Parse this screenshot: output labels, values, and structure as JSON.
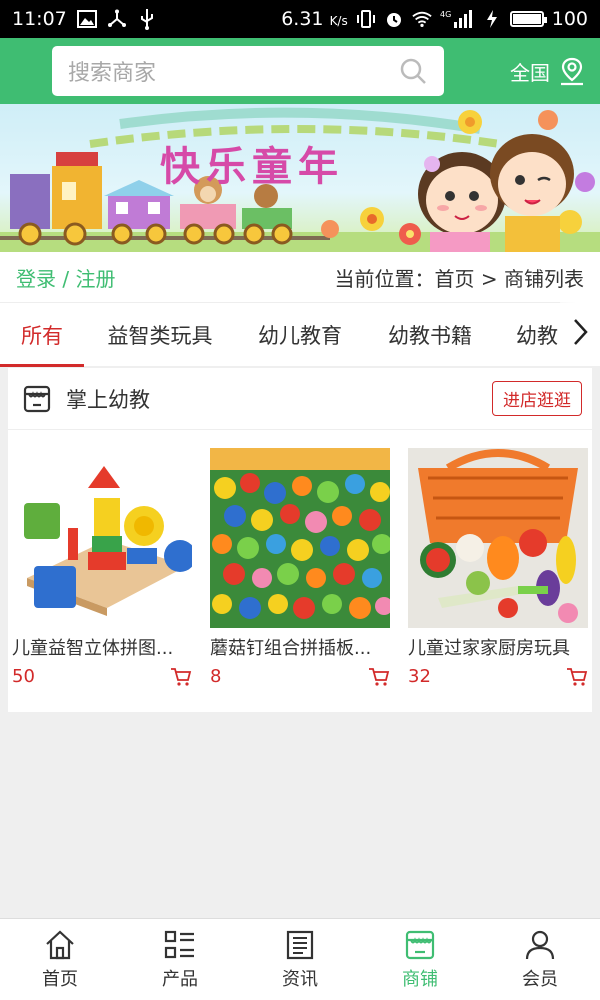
{
  "status_bar": {
    "time": "11:07",
    "speed": "6.31",
    "speed_unit": "K/s",
    "network": "4G",
    "battery": "100"
  },
  "header": {
    "search_placeholder": "搜索商家",
    "region": "全国"
  },
  "banner": {
    "title": "快乐童年"
  },
  "login": {
    "label": "登录 / 注册"
  },
  "breadcrumb": {
    "text": "当前位置：首页 > 商铺列表"
  },
  "tabs": [
    {
      "label": "所有",
      "active": true
    },
    {
      "label": "益智类玩具",
      "active": false
    },
    {
      "label": "幼儿教育",
      "active": false
    },
    {
      "label": "幼教书籍",
      "active": false
    },
    {
      "label": "幼教",
      "active": false
    }
  ],
  "shop": {
    "name": "掌上幼教",
    "visit_label": "进店逛逛",
    "products": [
      {
        "name": "儿童益智立体拼图...",
        "price": "50"
      },
      {
        "name": "蘑菇钉组合拼插板...",
        "price": "8"
      },
      {
        "name": "儿童过家家厨房玩具",
        "price": "32"
      }
    ]
  },
  "bottom_nav": [
    {
      "label": "首页",
      "icon": "home-icon",
      "active": false
    },
    {
      "label": "产品",
      "icon": "grid-list-icon",
      "active": false
    },
    {
      "label": "资讯",
      "icon": "news-icon",
      "active": false
    },
    {
      "label": "商铺",
      "icon": "shop-icon",
      "active": true
    },
    {
      "label": "会员",
      "icon": "user-icon",
      "active": false
    }
  ],
  "colors": {
    "brand_green": "#3fbd72",
    "accent_red": "#d22a2a"
  }
}
